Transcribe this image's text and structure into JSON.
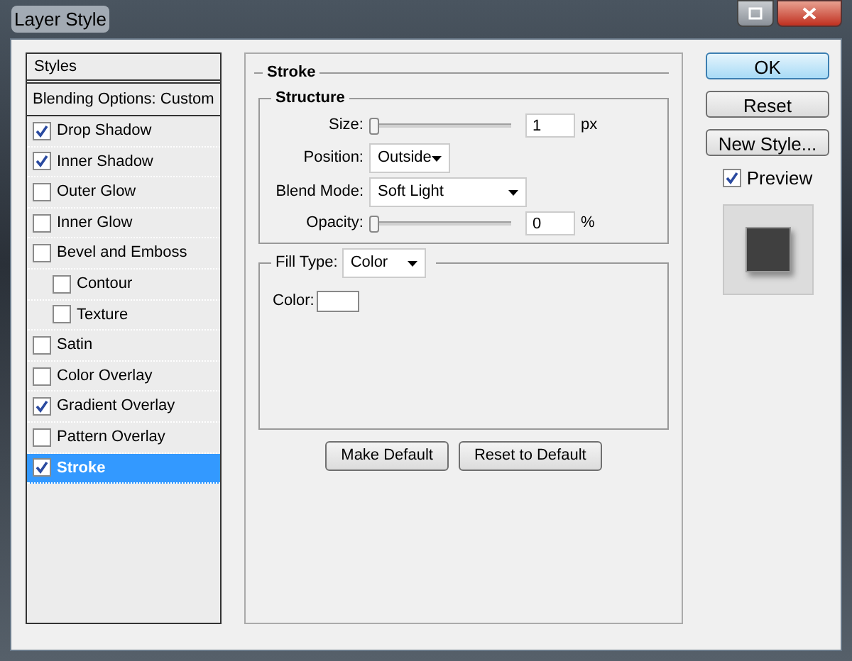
{
  "window": {
    "title": "Layer Style"
  },
  "styles_list": {
    "header": "Styles",
    "blending": "Blending Options: Custom",
    "items": [
      {
        "label": "Drop Shadow",
        "checked": true,
        "selected": false
      },
      {
        "label": "Inner Shadow",
        "checked": true,
        "selected": false
      },
      {
        "label": "Outer Glow",
        "checked": false,
        "selected": false
      },
      {
        "label": "Inner Glow",
        "checked": false,
        "selected": false
      },
      {
        "label": "Bevel and Emboss",
        "checked": false,
        "selected": false,
        "children": [
          {
            "label": "Contour",
            "checked": false,
            "selected": false
          },
          {
            "label": "Texture",
            "checked": false,
            "selected": false
          }
        ]
      },
      {
        "label": "Satin",
        "checked": false,
        "selected": false
      },
      {
        "label": "Color Overlay",
        "checked": false,
        "selected": false
      },
      {
        "label": "Gradient Overlay",
        "checked": true,
        "selected": false
      },
      {
        "label": "Pattern Overlay",
        "checked": false,
        "selected": false
      },
      {
        "label": "Stroke",
        "checked": true,
        "selected": true
      }
    ]
  },
  "stroke": {
    "title": "Stroke",
    "structure": {
      "title": "Structure",
      "size": {
        "label": "Size:",
        "level": 0,
        "value": "1",
        "unit": "px"
      },
      "position": {
        "label": "Position:",
        "value": "Outside"
      },
      "blend_mode": {
        "label": "Blend Mode:",
        "value": "Soft Light"
      },
      "opacity": {
        "label": "Opacity:",
        "level": 0,
        "value": "0",
        "unit": "%"
      }
    },
    "fill": {
      "label": "Fill Type:",
      "value": "Color",
      "color_label": "Color:"
    },
    "buttons": [
      "Make Default",
      "Reset to Default"
    ]
  },
  "side_buttons": [
    {
      "label": "OK",
      "default": true
    },
    {
      "label": "Reset",
      "default": false
    },
    {
      "label": "New Style...",
      "default": false
    }
  ],
  "preview": {
    "label": "Preview",
    "checked": true
  }
}
